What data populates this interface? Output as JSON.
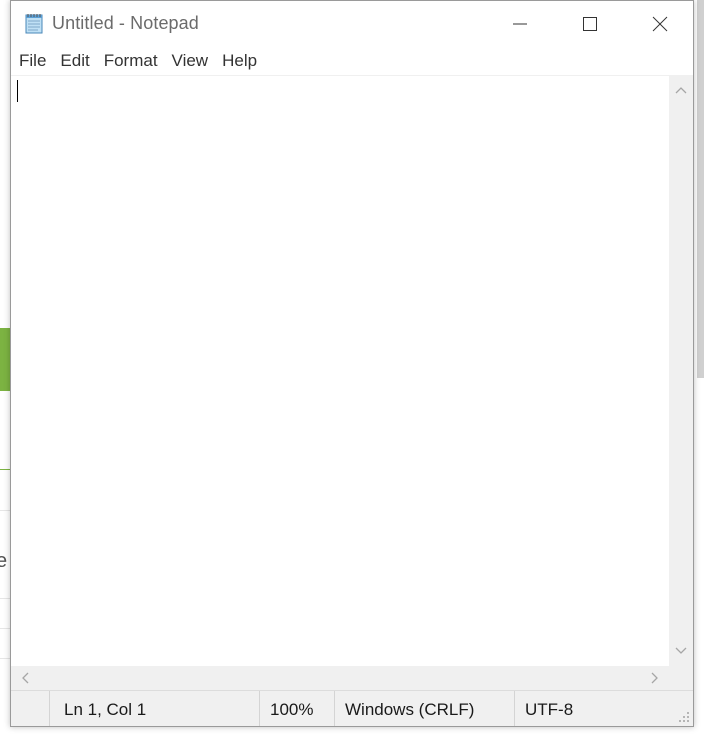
{
  "window": {
    "title": "Untitled - Notepad",
    "icon": "notepad-icon",
    "controls": {
      "minimize": "minimize-icon",
      "maximize": "maximize-icon",
      "close": "close-icon"
    }
  },
  "menu": {
    "items": [
      "File",
      "Edit",
      "Format",
      "View",
      "Help"
    ]
  },
  "editor": {
    "content": ""
  },
  "statusbar": {
    "position": "Ln 1, Col 1",
    "zoom": "100%",
    "line_ending": "Windows (CRLF)",
    "encoding": "UTF-8"
  },
  "background": {
    "left_text": "e",
    "accent_color": "#7cb342"
  }
}
